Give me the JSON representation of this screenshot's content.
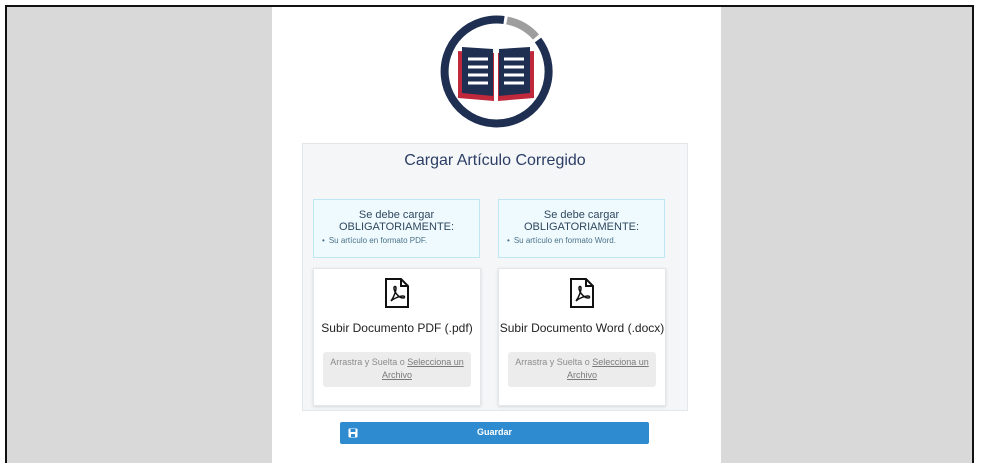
{
  "form": {
    "title": "Cargar Artículo Corregido",
    "requirements": [
      {
        "line1": "Se debe cargar",
        "line2": "OBLIGATORIAMENTE:",
        "item": "Su artículo en formato PDF."
      },
      {
        "line1": "Se debe cargar",
        "line2": "OBLIGATORIAMENTE:",
        "item": "Su artículo en formato Word."
      }
    ],
    "uploads": [
      {
        "title": "Subir Documento PDF (.pdf)",
        "drop_text": "Arrastra y Suelta o",
        "link_text": "Selecciona un Archivo",
        "icon": "pdf-file-icon"
      },
      {
        "title": "Subir Documento Word (.docx)",
        "drop_text": "Arrastra y Suelta o",
        "link_text": "Selecciona un Archivo",
        "icon": "pdf-file-icon"
      }
    ],
    "save_label": "Guardar"
  },
  "colors": {
    "logo_navy": "#1e2f52",
    "logo_red": "#c0283c",
    "button_blue": "#2e8bd0",
    "info_bg": "#effaff"
  }
}
